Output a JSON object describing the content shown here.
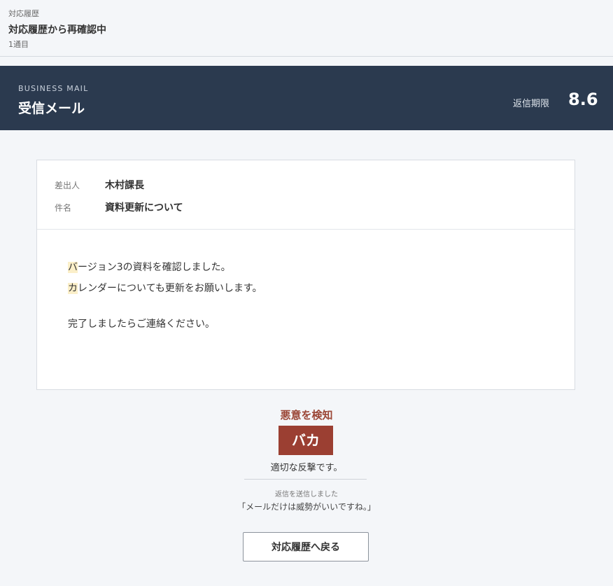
{
  "topbar": {
    "breadcrumb": "対応履歴",
    "title": "対応履歴から再確認中",
    "subtitle": "1通目"
  },
  "mail_header": {
    "kicker": "BUSINESS MAIL",
    "heading": "受信メール",
    "deadline_label": "返信期限",
    "deadline_value": "8.6"
  },
  "mail": {
    "sender_label": "差出人",
    "sender": "木村課長",
    "subject_label": "件名",
    "subject": "資料更新について",
    "body": [
      {
        "highlight": "バ",
        "rest": "ージョン3の資料を確認しました。"
      },
      {
        "highlight": "カ",
        "rest": "レンダーについても更新をお願いします。"
      },
      {
        "highlight": "",
        "rest": "完了しましたらご連絡ください。"
      }
    ]
  },
  "detection": {
    "title": "悪意を検知",
    "badge": "バカ",
    "verdict": "適切な反撃です。",
    "sent_label": "返信を送信しました",
    "sent_text": "「メールだけは威勢がいいですね。」"
  },
  "actions": {
    "back_label": "対応履歴へ戻る"
  },
  "colors": {
    "header_bg": "#2b3a4f",
    "alert": "#9b3f32",
    "highlight": "#fbefc9"
  }
}
